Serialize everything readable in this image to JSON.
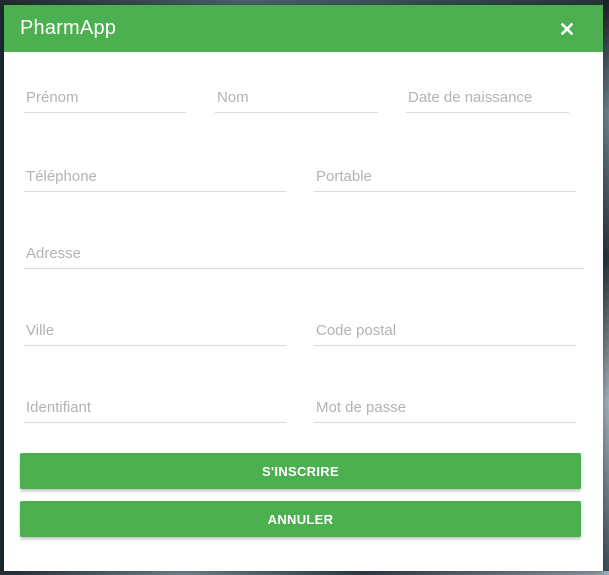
{
  "dialog": {
    "title": "PharmApp",
    "close_icon": "close-icon"
  },
  "form": {
    "prenom_placeholder": "Prénom",
    "nom_placeholder": "Nom",
    "date_naissance_placeholder": "Date de naissance",
    "telephone_placeholder": "Téléphone",
    "portable_placeholder": "Portable",
    "adresse_placeholder": "Adresse",
    "ville_placeholder": "Ville",
    "code_postal_placeholder": "Code postal",
    "identifiant_placeholder": "Identifiant",
    "mot_de_passe_placeholder": "Mot de passe"
  },
  "actions": {
    "register_label": "S'INSCRIRE",
    "cancel_label": "ANNULER"
  },
  "colors": {
    "primary": "#4caf50",
    "underline": "#d9d9d9",
    "placeholder": "#b3b3b3"
  }
}
